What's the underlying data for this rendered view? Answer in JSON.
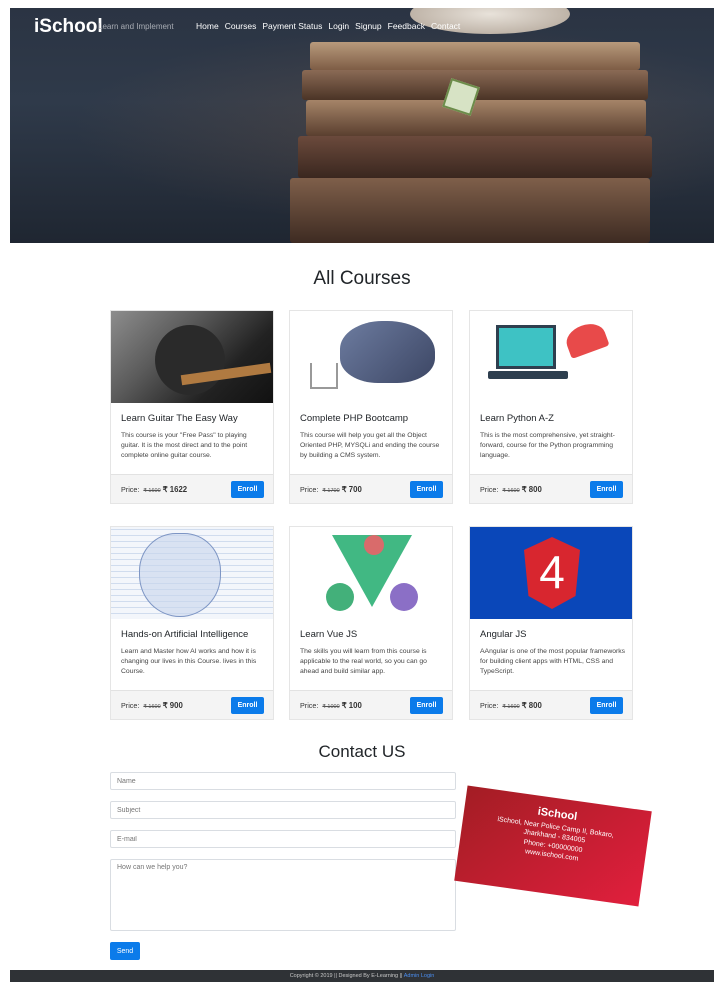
{
  "brand": {
    "name": "iSchool",
    "tagline": "Learn and Implement"
  },
  "nav": [
    "Home",
    "Courses",
    "Payment Status",
    "Login",
    "Signup",
    "Feedback",
    "Contact"
  ],
  "sections": {
    "courses_title": "All Courses",
    "contact_title": "Contact US"
  },
  "courses": [
    {
      "title": "Learn Guitar The Easy Way",
      "description": "This course is your \"Free Pass\" to playing guitar. It is the most direct and to the point complete online guitar course.",
      "price_label": "Price:",
      "old_price": "₹ 1600",
      "new_price": "₹ 1622",
      "button": "Enroll"
    },
    {
      "title": "Complete PHP Bootcamp",
      "description": "This course will help you get all the Object Oriented PHP, MYSQLi and ending the course by building a CMS system.",
      "price_label": "Price:",
      "old_price": "₹ 1700",
      "new_price": "₹ 700",
      "button": "Enroll"
    },
    {
      "title": "Learn Python A-Z",
      "description": "This is the most comprehensive, yet straight-forward, course for the Python programming language.",
      "price_label": "Price:",
      "old_price": "₹ 1600",
      "new_price": "₹ 800",
      "button": "Enroll"
    },
    {
      "title": "Hands-on Artificial Intelligence",
      "description": "Learn and Master how AI works and how it is changing our lives in this Course. lives in this Course.",
      "price_label": "Price:",
      "old_price": "₹ 1600",
      "new_price": "₹ 900",
      "button": "Enroll"
    },
    {
      "title": "Learn Vue JS",
      "description": "The skills you will learn from this course is applicable to the real world, so you can go ahead and build similar app.",
      "price_label": "Price:",
      "old_price": "₹ 1000",
      "new_price": "₹ 100",
      "button": "Enroll"
    },
    {
      "title": "Angular JS",
      "description": "AAngular is one of the most popular frameworks for building client apps with HTML, CSS and TypeScript.",
      "price_label": "Price:",
      "old_price": "₹ 1600",
      "new_price": "₹ 800",
      "button": "Enroll"
    }
  ],
  "angular_badge": "4",
  "contact": {
    "name_placeholder": "Name",
    "subject_placeholder": "Subject",
    "email_placeholder": "E-mail",
    "message_placeholder": "How can we help you?",
    "send_label": "Send"
  },
  "business_card": {
    "name": "iSchool",
    "address1": "iSchool, Near Police Camp II, Bokaro,",
    "address2": "Jharkhand - 834005",
    "phone": "Phone: +00000000",
    "web": "www.ischool.com"
  },
  "footer": {
    "text": "Copyright © 2019 || Designed By E-Learning ||",
    "admin_link": "Admin Login"
  },
  "colors": {
    "primary": "#0b7bea",
    "hero_bg": "#2b3443",
    "footer_bg": "#2f3236",
    "card_red": "#d41f32"
  }
}
